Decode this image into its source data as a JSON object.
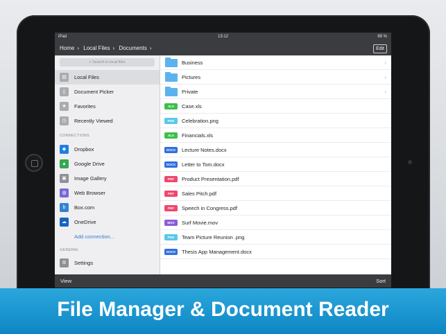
{
  "status": {
    "device": "iPad",
    "time": "13:12",
    "battery": "89 %"
  },
  "nav": {
    "crumbs": [
      "Home",
      "Local Files",
      "Documents"
    ],
    "edit": "Edit"
  },
  "search": {
    "placeholder": "Search in local files"
  },
  "sidebar": {
    "items": [
      {
        "label": "Local Files",
        "icon": "folder-icon",
        "color": "#a9abb0"
      },
      {
        "label": "Document Picker",
        "icon": "document-icon",
        "color": "#a9abb0"
      },
      {
        "label": "Favorites",
        "icon": "star-icon",
        "color": "#a9abb0"
      },
      {
        "label": "Recently Viewed",
        "icon": "clock-icon",
        "color": "#a9abb0"
      }
    ],
    "connections_title": "CONNECTIONS",
    "connections": [
      {
        "label": "Dropbox",
        "icon": "dropbox-icon",
        "color": "#1f7fe0"
      },
      {
        "label": "Google Drive",
        "icon": "google-drive-icon",
        "color": "#34a853"
      },
      {
        "label": "Image Gallery",
        "icon": "image-icon",
        "color": "#8e9096"
      },
      {
        "label": "Web Browser",
        "icon": "globe-icon",
        "color": "#7a68d6"
      },
      {
        "label": "Box.com",
        "icon": "box-icon",
        "color": "#2f84d0"
      },
      {
        "label": "OneDrive",
        "icon": "cloud-icon",
        "color": "#1565c0"
      },
      {
        "label": "Add connection...",
        "icon": "",
        "color": ""
      }
    ],
    "general_title": "GENERAL",
    "general": [
      {
        "label": "Settings",
        "icon": "gear-icon",
        "color": "#8e9096"
      }
    ]
  },
  "files": [
    {
      "name": "Business",
      "type": "folder"
    },
    {
      "name": "Pictures",
      "type": "folder"
    },
    {
      "name": "Private",
      "type": "folder"
    },
    {
      "name": "Case.xls",
      "type": "XLS",
      "color": "#3cbf4a"
    },
    {
      "name": "Celebration.png",
      "type": "PNG",
      "color": "#5ac8e8"
    },
    {
      "name": "Financials.xls",
      "type": "XLS",
      "color": "#3cbf4a"
    },
    {
      "name": "Lecture Notes.docx",
      "type": "DOCX",
      "color": "#2f6fe0"
    },
    {
      "name": "Letter to Tom.docx",
      "type": "DOCX",
      "color": "#2f6fe0"
    },
    {
      "name": "Product Presentation.pdf",
      "type": "PDF",
      "color": "#f0466e"
    },
    {
      "name": "Sales Pitch.pdf",
      "type": "PDF",
      "color": "#f0466e"
    },
    {
      "name": "Speech in Congress.pdf",
      "type": "PDF",
      "color": "#f0466e"
    },
    {
      "name": "Surf Movie.mov",
      "type": "MOV",
      "color": "#8d5bd8"
    },
    {
      "name": "Team Picture Reunion .png",
      "type": "PNG",
      "color": "#5ac8e8"
    },
    {
      "name": "Thesis App Management.docx",
      "type": "DOCX",
      "color": "#2f6fe0"
    }
  ],
  "toolbar": {
    "view": "View",
    "sort": "Sort"
  },
  "banner": {
    "title": "File Manager & Document Reader"
  }
}
